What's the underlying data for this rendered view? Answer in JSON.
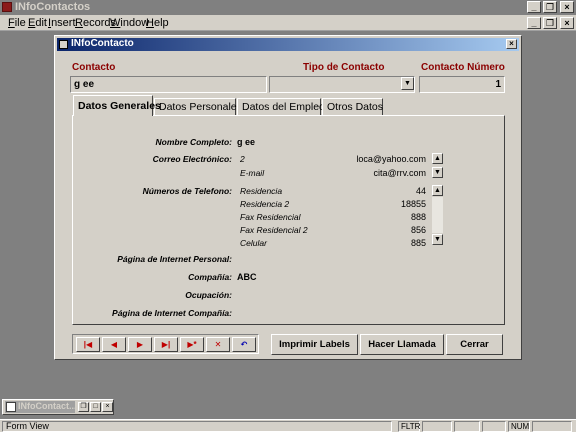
{
  "app": {
    "title": "INfoContactos"
  },
  "menu": [
    "File",
    "Edit",
    "Insert",
    "Records",
    "Window",
    "Help"
  ],
  "form": {
    "title": "INfoContacto",
    "header": {
      "contacto_label": "Contacto",
      "tipo_label": "Tipo de Contacto",
      "numero_label": "Contacto Número",
      "contacto_value": "g ee",
      "tipo_value": "",
      "numero_value": "1"
    },
    "tabs": [
      "Datos Generales",
      "Datos Personales",
      "Datos del Empleo",
      "Otros Datos"
    ],
    "general": {
      "nombre_label": "Nombre Completo:",
      "nombre_value": "g ee",
      "correo_label": "Correo Electrónico:",
      "correo_rows": [
        {
          "label": "2",
          "value": "loca@yahoo.com"
        },
        {
          "label": "E-mail",
          "value": "cita@rrv.com"
        }
      ],
      "telefono_label": "Números de Telefono:",
      "telefono_rows": [
        {
          "label": "Residencia",
          "value": "44"
        },
        {
          "label": "Residencia 2",
          "value": "18855"
        },
        {
          "label": "Fax Residencial",
          "value": "888"
        },
        {
          "label": "Fax Residencial 2",
          "value": "856"
        },
        {
          "label": "Celular",
          "value": "885"
        }
      ],
      "pagina_personal_label": "Página de Internet Personal:",
      "pagina_personal_value": "",
      "compania_label": "Compañía:",
      "compania_value": "ABC",
      "ocupacion_label": "Ocupación:",
      "ocupacion_value": "",
      "pagina_compania_label": "Página de Internet Compañía:",
      "pagina_compania_value": ""
    },
    "buttons": {
      "imprimir": "Imprimir Labels",
      "llamada": "Hacer Llamada",
      "cerrar": "Cerrar"
    }
  },
  "minimized": {
    "title": "INfoContact..."
  },
  "status": {
    "text": "Form View",
    "flags": [
      "FLTR",
      "NUM"
    ]
  },
  "colors": {
    "label_red": "#8b0000",
    "title_blue": "#0a246a",
    "nav_red": "#c00000"
  }
}
